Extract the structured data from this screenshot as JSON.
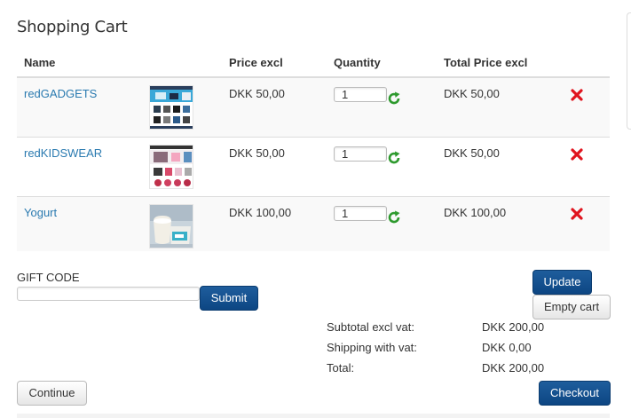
{
  "page": {
    "title": "Shopping Cart"
  },
  "table": {
    "headers": {
      "name": "Name",
      "price": "Price excl",
      "quantity": "Quantity",
      "total": "Total Price excl"
    },
    "rows": [
      {
        "name": "redGADGETS",
        "price": "DKK 50,00",
        "quantity": "1",
        "total": "DKK 50,00"
      },
      {
        "name": "redKIDSWEAR",
        "price": "DKK 50,00",
        "quantity": "1",
        "total": "DKK 50,00"
      },
      {
        "name": "Yogurt",
        "price": "DKK 100,00",
        "quantity": "1",
        "total": "DKK 100,00"
      }
    ]
  },
  "gift": {
    "label": "GIFT CODE",
    "value": "",
    "submit_label": "Submit"
  },
  "actions": {
    "update_label": "Update",
    "empty_cart_label": "Empty cart",
    "continue_label": "Continue",
    "checkout_label": "Checkout"
  },
  "totals": {
    "subtotal_label": "Subtotal excl vat:",
    "subtotal_value": "DKK 200,00",
    "shipping_label": "Shipping with vat:",
    "shipping_value": "DKK 0,00",
    "total_label": "Total:",
    "total_value": "DKK 200,00"
  },
  "icons": {
    "refresh": "refresh-icon",
    "remove": "remove-icon"
  },
  "colors": {
    "link": "#2a7ab0",
    "primary_button": "#0d4683",
    "refresh_icon": "#2e9a2e",
    "remove_icon": "#e0141e"
  }
}
